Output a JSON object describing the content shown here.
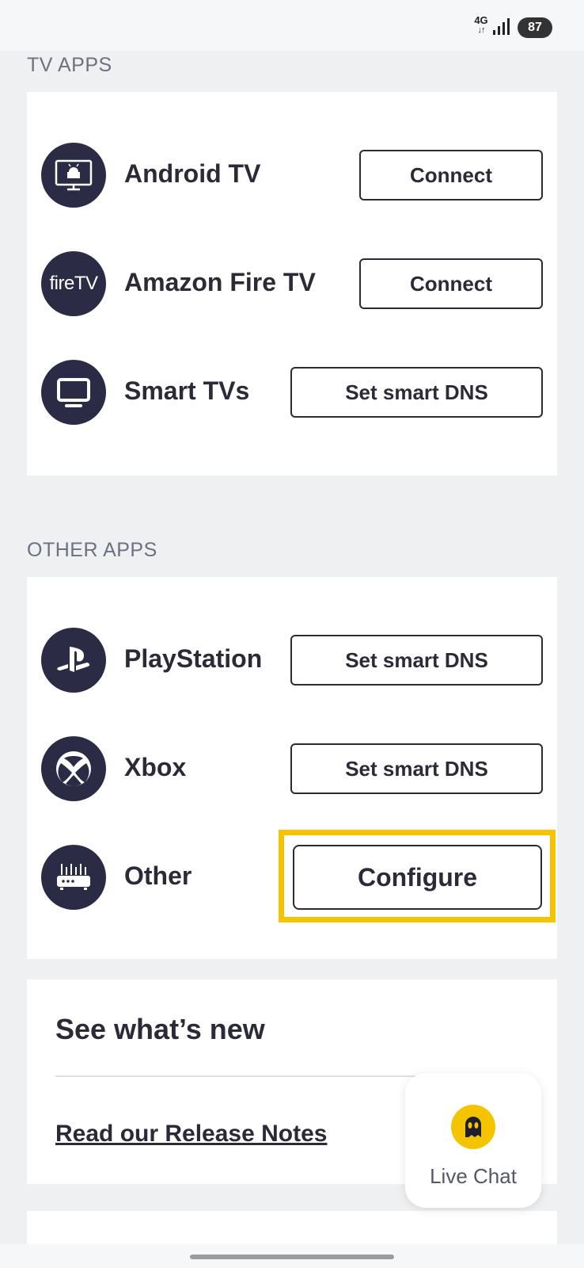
{
  "status_bar": {
    "network": "4G",
    "battery": "87"
  },
  "sections": {
    "tv_apps": {
      "title": "TV APPS",
      "items": [
        {
          "label": "Android TV",
          "button": "Connect",
          "icon": "android-tv-icon"
        },
        {
          "label": "Amazon Fire TV",
          "button": "Connect",
          "icon": "fire-tv-icon",
          "icon_text": "fireTV"
        },
        {
          "label": "Smart TVs",
          "button": "Set smart DNS",
          "icon": "tv-monitor-icon"
        }
      ]
    },
    "other_apps": {
      "title": "OTHER APPS",
      "items": [
        {
          "label": "PlayStation",
          "button": "Set smart DNS",
          "icon": "playstation-icon"
        },
        {
          "label": "Xbox",
          "button": "Set smart DNS",
          "icon": "xbox-icon"
        },
        {
          "label": "Other",
          "button": "Configure",
          "icon": "router-icon"
        }
      ]
    }
  },
  "whats_new": {
    "title": "See what’s new",
    "link": "Read our Release Notes"
  },
  "live_chat": {
    "label": "Live Chat"
  },
  "colors": {
    "accent": "#f4c400",
    "icon_bg": "#2b2b45",
    "text": "#2b2b38",
    "background": "#eff0f2"
  }
}
